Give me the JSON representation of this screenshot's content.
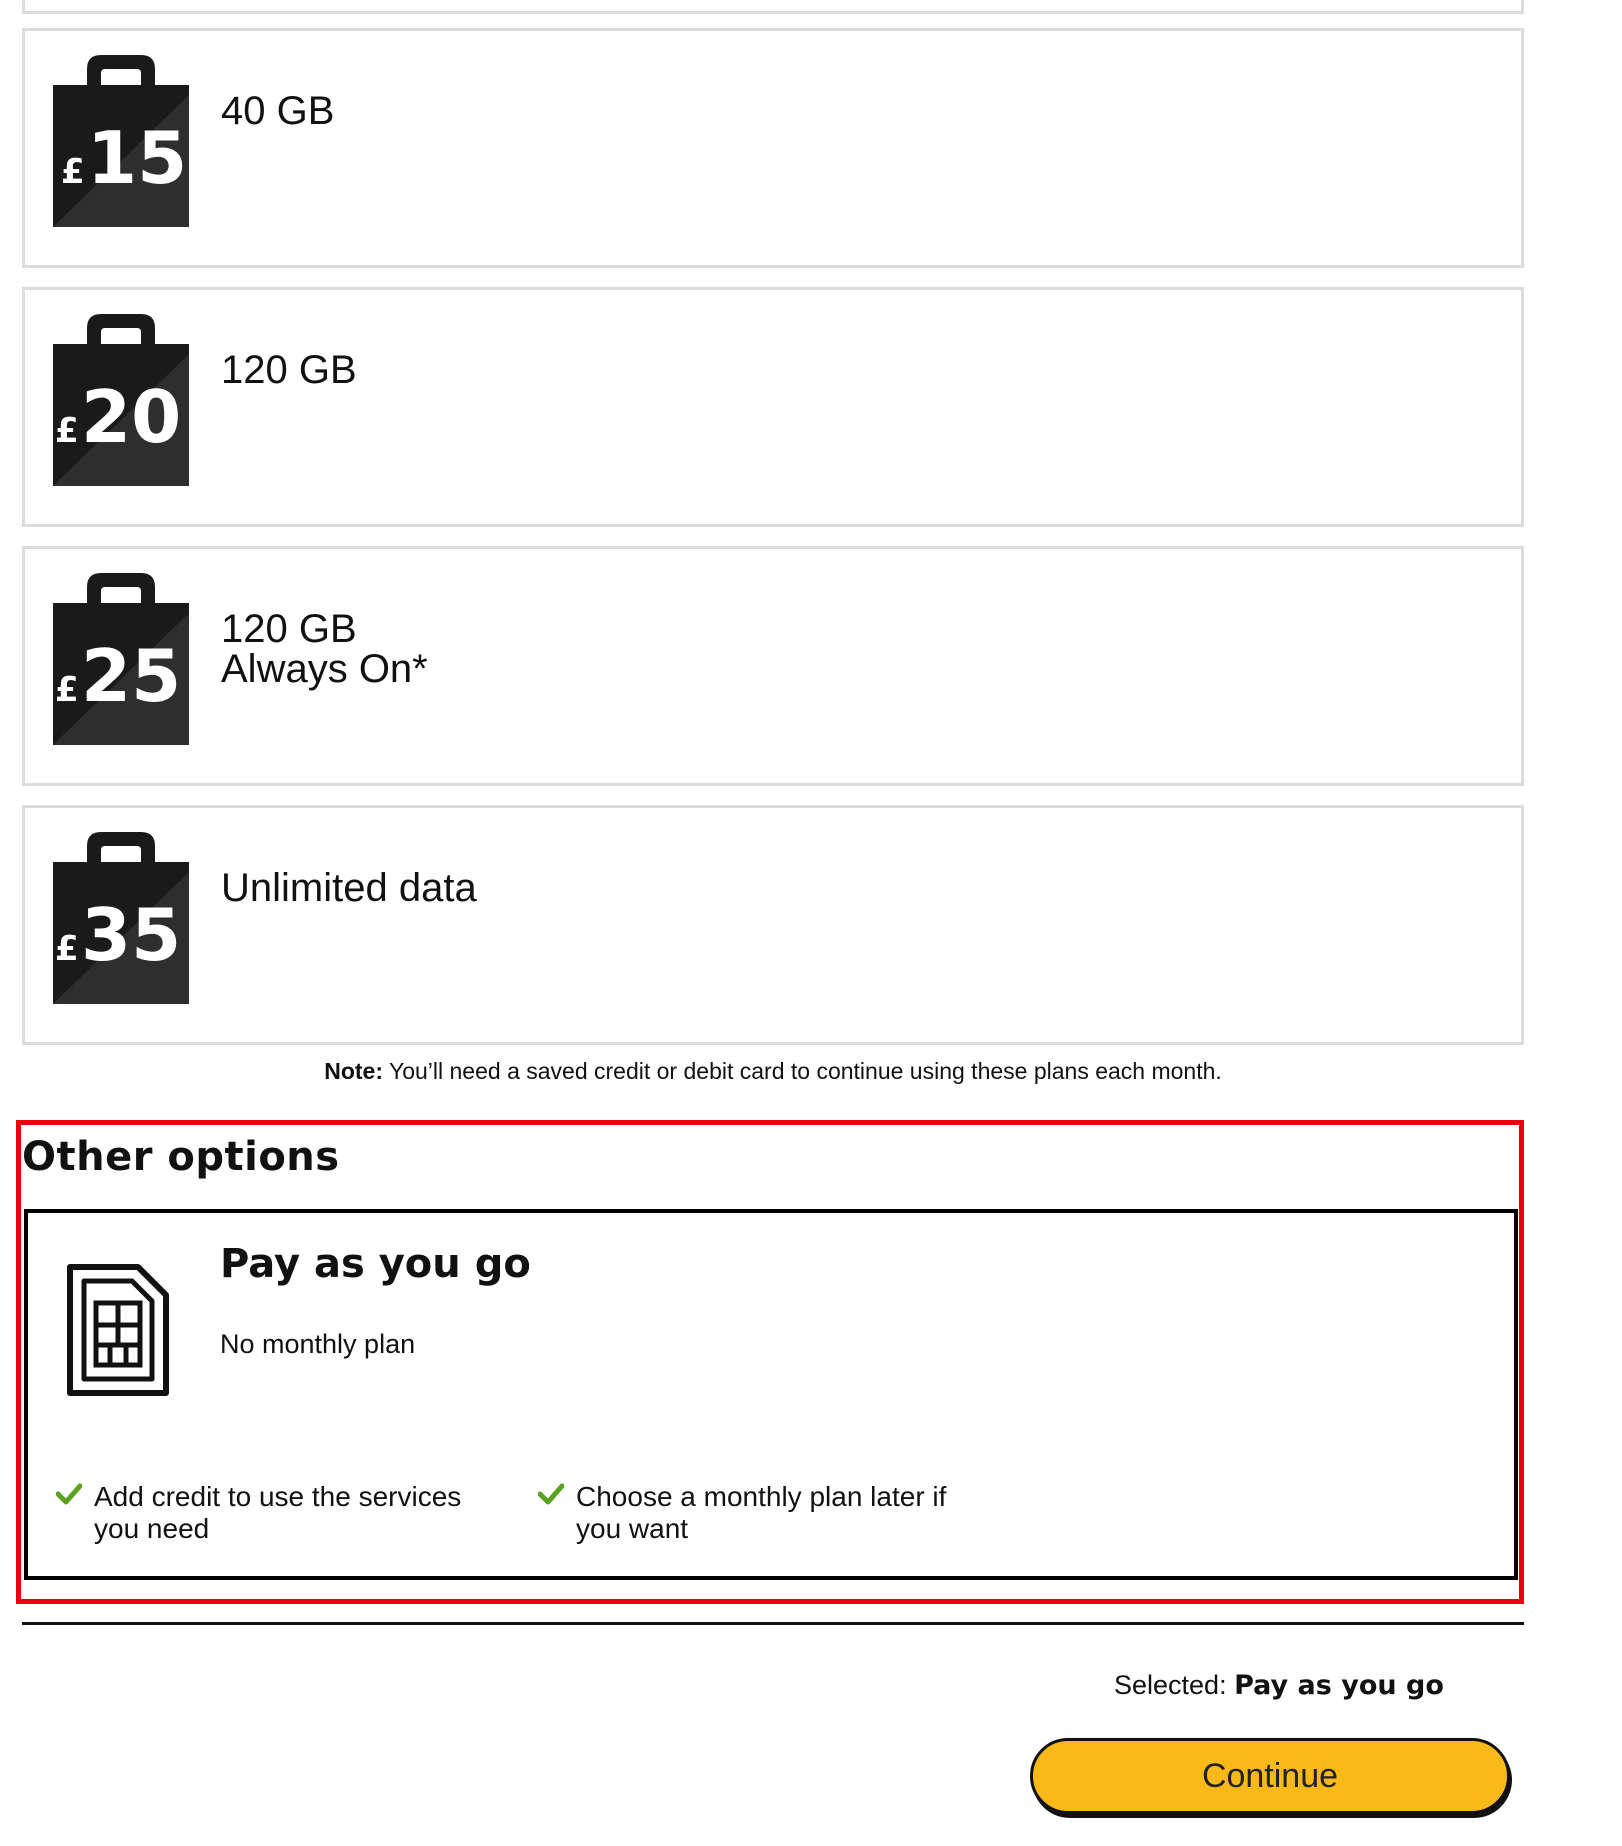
{
  "plans": [
    {
      "price_symbol": "£",
      "price": "15",
      "line1": "40 GB",
      "line2": ""
    },
    {
      "price_symbol": "£",
      "price": "20",
      "line1": "120 GB",
      "line2": ""
    },
    {
      "price_symbol": "£",
      "price": "25",
      "line1": "120 GB",
      "line2": "Always On*"
    },
    {
      "price_symbol": "£",
      "price": "35",
      "line1": "Unlimited data",
      "line2": ""
    }
  ],
  "note": {
    "label": "Note:",
    "text": " You’ll need a saved credit or debit card to continue using these plans each month."
  },
  "other_options": {
    "title": "Other options",
    "payg": {
      "title": "Pay as you go",
      "subtitle": "No monthly plan",
      "features": [
        "Add credit to use the services you need",
        "Choose a monthly plan later if you want"
      ]
    }
  },
  "footer": {
    "selected_label": "Selected: ",
    "selected_value": "Pay as you go",
    "continue_label": "Continue"
  },
  "icons": {
    "plan_icon": "price-bag-icon",
    "payg_icon": "sim-card-icon",
    "feature_icon": "check-icon"
  },
  "colors": {
    "accent": "#f9b919",
    "highlight": "#e8000f",
    "check": "#5aa21d",
    "bag": "#1a1a1a"
  }
}
